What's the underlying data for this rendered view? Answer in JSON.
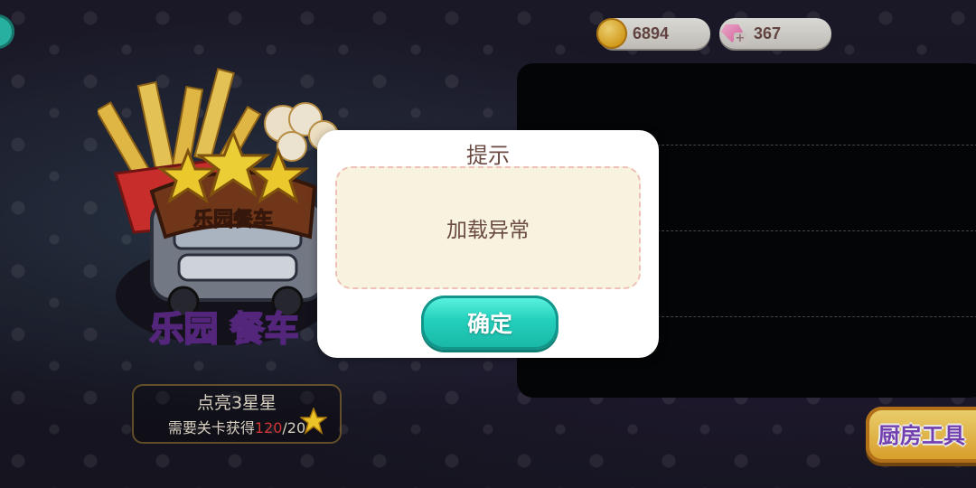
{
  "currencies": {
    "coins": "6894",
    "gems": "367"
  },
  "truck": {
    "logo_text": "乐园餐车",
    "name_text": "乐园 餐车"
  },
  "star_requirement": {
    "title": "点亮3星星",
    "label": "需要关卡获得",
    "current": "120",
    "separator": "/",
    "required": "20"
  },
  "kitchen_button": {
    "label": "厨房工具"
  },
  "dialog": {
    "title": "提示",
    "message": "加载异常",
    "confirm_label": "确定"
  }
}
